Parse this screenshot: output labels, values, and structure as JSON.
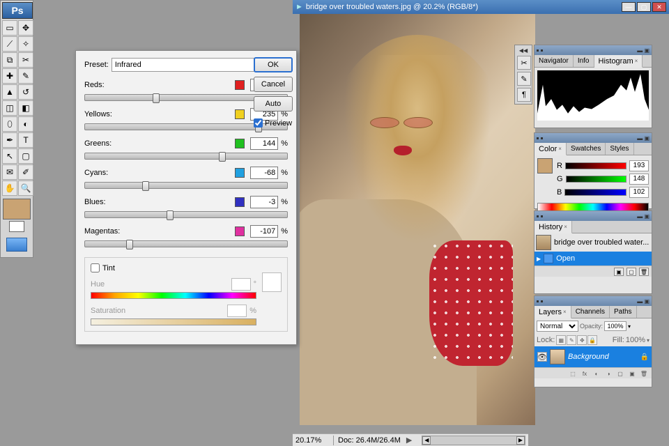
{
  "app": {
    "logo": "Ps"
  },
  "document": {
    "caret": "►",
    "title": "bridge over troubled waters.jpg @ 20.2% (RGB/8*)",
    "zoom_status": "20.17%",
    "doc_status": "Doc: 26.4M/26.4M"
  },
  "bw_dialog": {
    "preset_label": "Preset:",
    "preset_value": "Infrared",
    "percent": "%",
    "degree": "°",
    "channels": [
      {
        "name": "Reds:",
        "color": "#e02020",
        "value": "-40",
        "pos": 35
      },
      {
        "name": "Yellows:",
        "color": "#f0d020",
        "value": "235",
        "pos": 86
      },
      {
        "name": "Greens:",
        "color": "#20c020",
        "value": "144",
        "pos": 68
      },
      {
        "name": "Cyans:",
        "color": "#20a0e0",
        "value": "-68",
        "pos": 30
      },
      {
        "name": "Blues:",
        "color": "#3030c0",
        "value": "-3",
        "pos": 42
      },
      {
        "name": "Magentas:",
        "color": "#e030a0",
        "value": "-107",
        "pos": 22
      }
    ],
    "tint_label": "Tint",
    "hue_label": "Hue",
    "sat_label": "Saturation"
  },
  "dlg_buttons": {
    "ok": "OK",
    "cancel": "Cancel",
    "auto": "Auto",
    "preview": "Preview"
  },
  "panels": {
    "nav_tabs": [
      "Navigator",
      "Info",
      "Histogram"
    ],
    "color_tabs": [
      "Color",
      "Swatches",
      "Styles"
    ],
    "history_tabs": [
      "History"
    ],
    "layers_tabs": [
      "Layers",
      "Channels",
      "Paths"
    ]
  },
  "color_panel": {
    "r_label": "R",
    "g_label": "G",
    "b_label": "B",
    "r": "193",
    "g": "148",
    "b": "102"
  },
  "history": {
    "file": "bridge over troubled water...",
    "step": "Open"
  },
  "layers": {
    "blend": "Normal",
    "opacity_label": "Opacity:",
    "opacity": "100%",
    "lock_label": "Lock:",
    "fill_label": "Fill:",
    "fill": "100%",
    "layer0": "Background"
  }
}
